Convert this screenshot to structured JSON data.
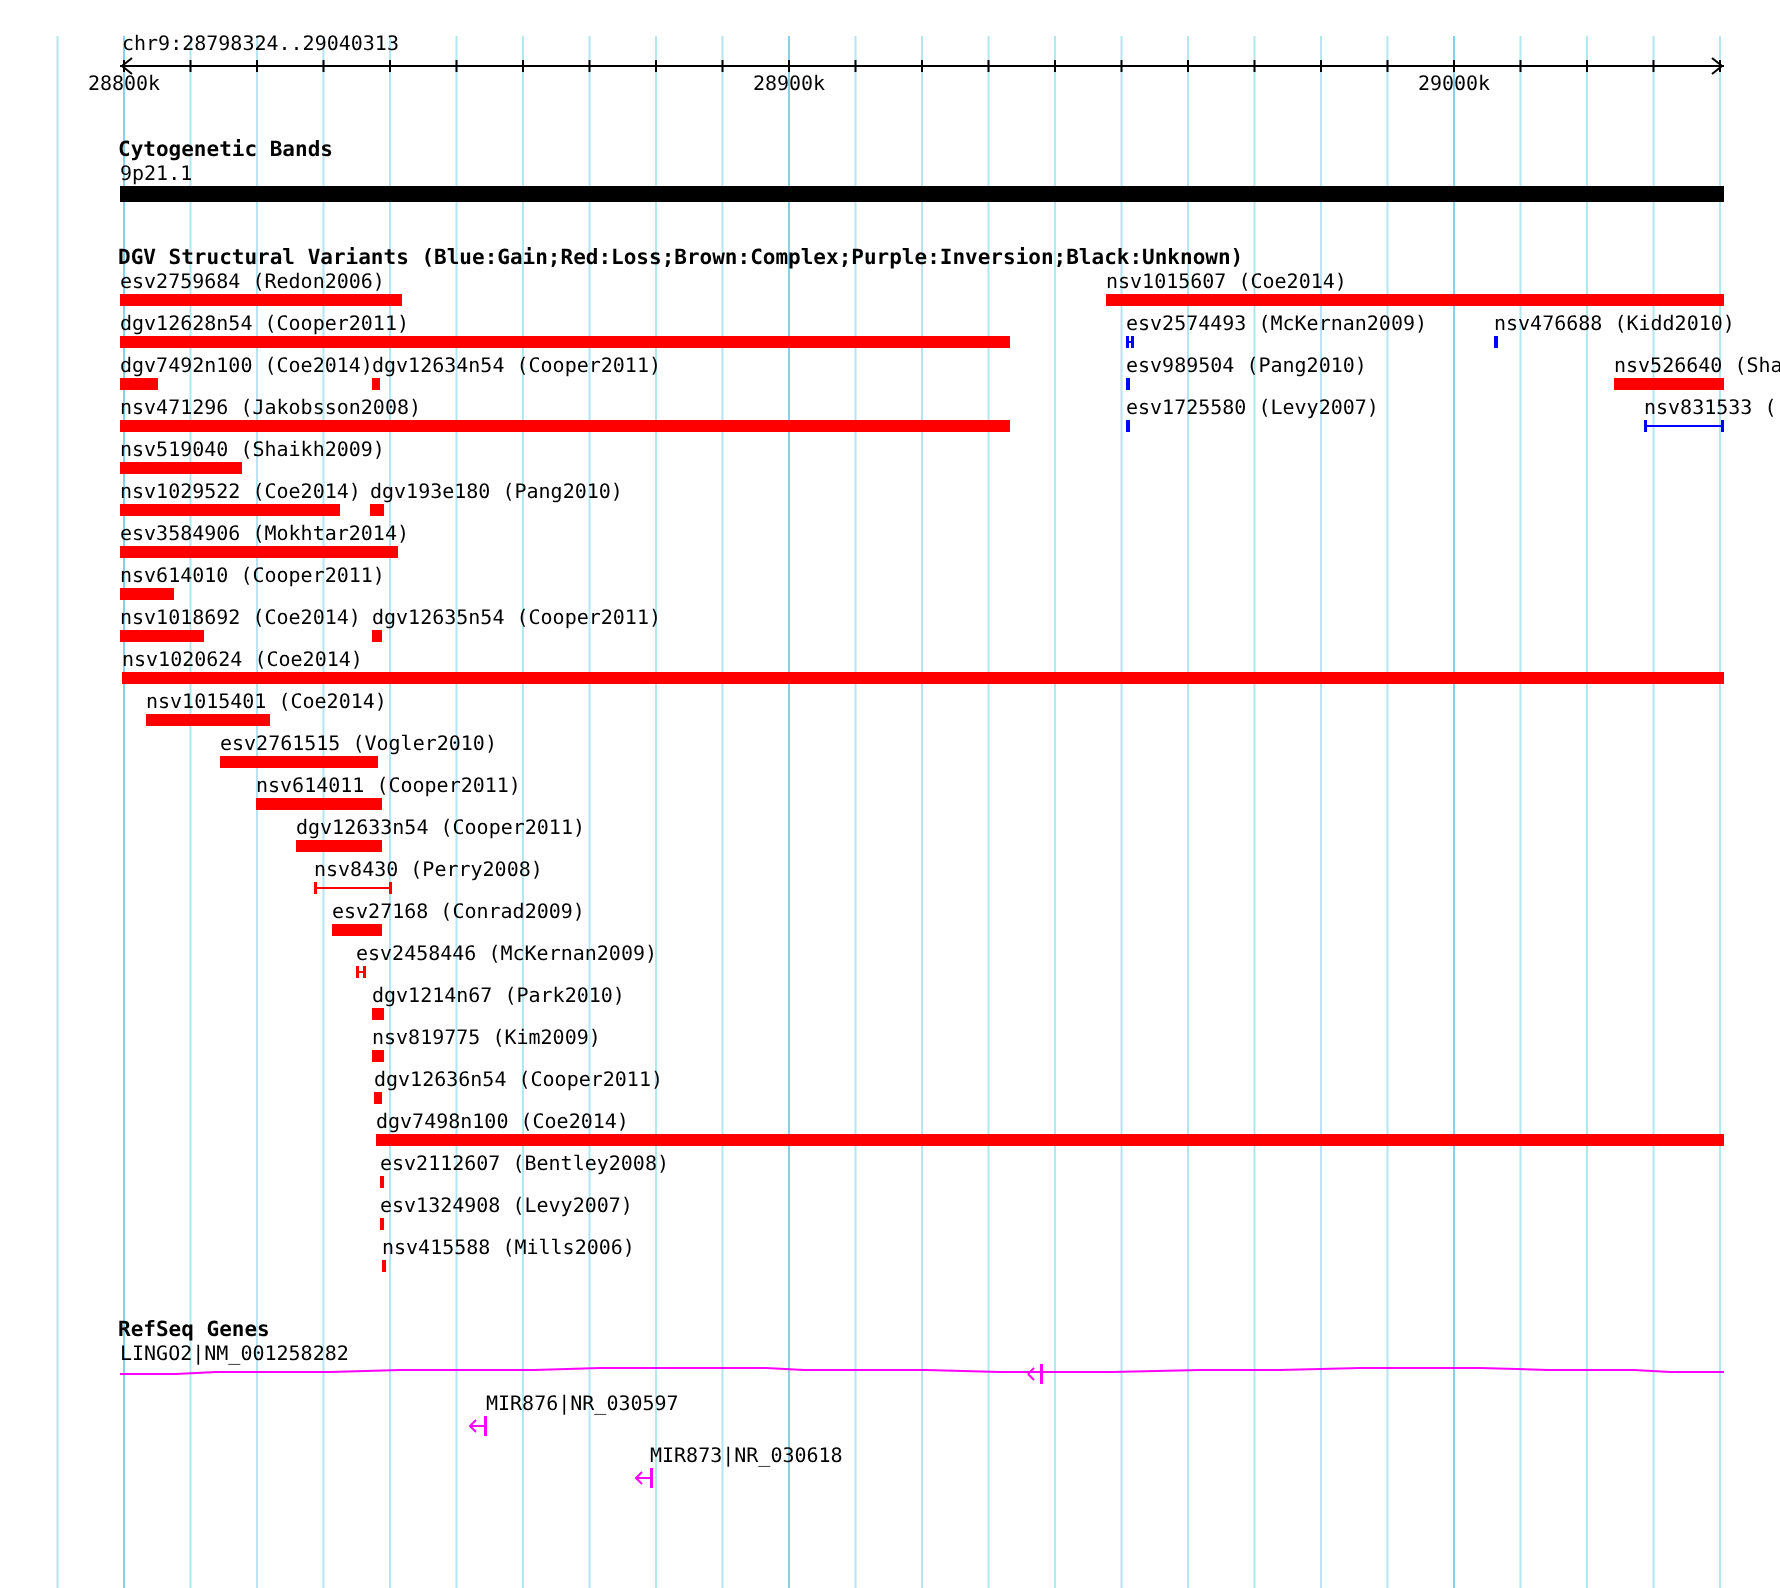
{
  "ruler": {
    "position": "chr9:28798324..29040313",
    "ticks": [
      "28800k",
      "28900k",
      "29000k"
    ]
  },
  "tracks": [
    {
      "kind": "bands",
      "title": "Cytogenetic Bands",
      "features": [
        {
          "label": "9p21.1",
          "color": "#000000"
        }
      ]
    },
    {
      "kind": "variants",
      "title": "DGV Structural Variants (Blue:Gain;Red:Loss;Brown:Complex;Purple:Inversion;Black:Unknown)",
      "features": [
        {
          "label": "esv2759684 (Redon2006)",
          "kind": "bar",
          "color": "#ff0000"
        },
        {
          "label": "nsv1015607 (Coe2014)",
          "kind": "bar",
          "color": "#ff0000"
        },
        {
          "label": "dgv12628n54 (Cooper2011)",
          "kind": "bar",
          "color": "#ff0000"
        },
        {
          "label": "esv2574493 (McKernan2009)",
          "kind": "span",
          "color": "#0000ff"
        },
        {
          "label": "nsv476688 (Kidd2010)",
          "kind": "bar",
          "color": "#0000ff"
        },
        {
          "label": "dgv7492n100 (Coe2014)",
          "kind": "bar",
          "color": "#ff0000"
        },
        {
          "label": "dgv12634n54 (Cooper2011)",
          "kind": "bar",
          "color": "#ff0000"
        },
        {
          "label": "esv989504 (Pang2010)",
          "kind": "bar",
          "color": "#0000ff"
        },
        {
          "label": "nsv526640 (Sha",
          "kind": "bar",
          "color": "#ff0000"
        },
        {
          "label": "nsv471296 (Jakobsson2008)",
          "kind": "bar",
          "color": "#ff0000"
        },
        {
          "label": "esv1725580 (Levy2007)",
          "kind": "bar",
          "color": "#0000ff"
        },
        {
          "label": "nsv831533 (",
          "kind": "span",
          "color": "#0000ff"
        },
        {
          "label": "nsv519040 (Shaikh2009)",
          "kind": "bar",
          "color": "#ff0000"
        },
        {
          "label": "nsv1029522 (Coe2014)",
          "kind": "bar",
          "color": "#ff0000"
        },
        {
          "label": "dgv193e180 (Pang2010)",
          "kind": "bar",
          "color": "#ff0000"
        },
        {
          "label": "esv3584906 (Mokhtar2014)",
          "kind": "bar",
          "color": "#ff0000"
        },
        {
          "label": "nsv614010 (Cooper2011)",
          "kind": "bar",
          "color": "#ff0000"
        },
        {
          "label": "nsv1018692 (Coe2014)",
          "kind": "bar",
          "color": "#ff0000"
        },
        {
          "label": "dgv12635n54 (Cooper2011)",
          "kind": "bar",
          "color": "#ff0000"
        },
        {
          "label": "nsv1020624 (Coe2014)",
          "kind": "bar",
          "color": "#ff0000"
        },
        {
          "label": "nsv1015401 (Coe2014)",
          "kind": "bar",
          "color": "#ff0000"
        },
        {
          "label": "esv2761515 (Vogler2010)",
          "kind": "bar",
          "color": "#ff0000"
        },
        {
          "label": "nsv614011 (Cooper2011)",
          "kind": "bar",
          "color": "#ff0000"
        },
        {
          "label": "dgv12633n54 (Cooper2011)",
          "kind": "bar",
          "color": "#ff0000"
        },
        {
          "label": "nsv8430 (Perry2008)",
          "kind": "span",
          "color": "#ff0000"
        },
        {
          "label": "esv27168 (Conrad2009)",
          "kind": "bar",
          "color": "#ff0000"
        },
        {
          "label": "esv2458446 (McKernan2009)",
          "kind": "span",
          "color": "#ff0000"
        },
        {
          "label": "dgv1214n67 (Park2010)",
          "kind": "bar",
          "color": "#ff0000"
        },
        {
          "label": "nsv819775 (Kim2009)",
          "kind": "bar",
          "color": "#ff0000"
        },
        {
          "label": "dgv12636n54 (Cooper2011)",
          "kind": "bar",
          "color": "#ff0000"
        },
        {
          "label": "dgv7498n100 (Coe2014)",
          "kind": "bar",
          "color": "#ff0000"
        },
        {
          "label": "esv2112607 (Bentley2008)",
          "kind": "bar",
          "color": "#ff0000"
        },
        {
          "label": "esv1324908 (Levy2007)",
          "kind": "bar",
          "color": "#ff0000"
        },
        {
          "label": "nsv415588 (Mills2006)",
          "kind": "bar",
          "color": "#ff0000"
        }
      ]
    },
    {
      "kind": "genes",
      "title": "RefSeq Genes",
      "features": [
        {
          "label": "LINGO2|NM_001258282",
          "kind": "gene",
          "color": "#ff00ff"
        },
        {
          "label": "MIR876|NR_030597",
          "kind": "gene",
          "color": "#ff00ff"
        },
        {
          "label": "MIR873|NR_030618",
          "kind": "gene",
          "color": "#ff00ff"
        }
      ]
    }
  ]
}
